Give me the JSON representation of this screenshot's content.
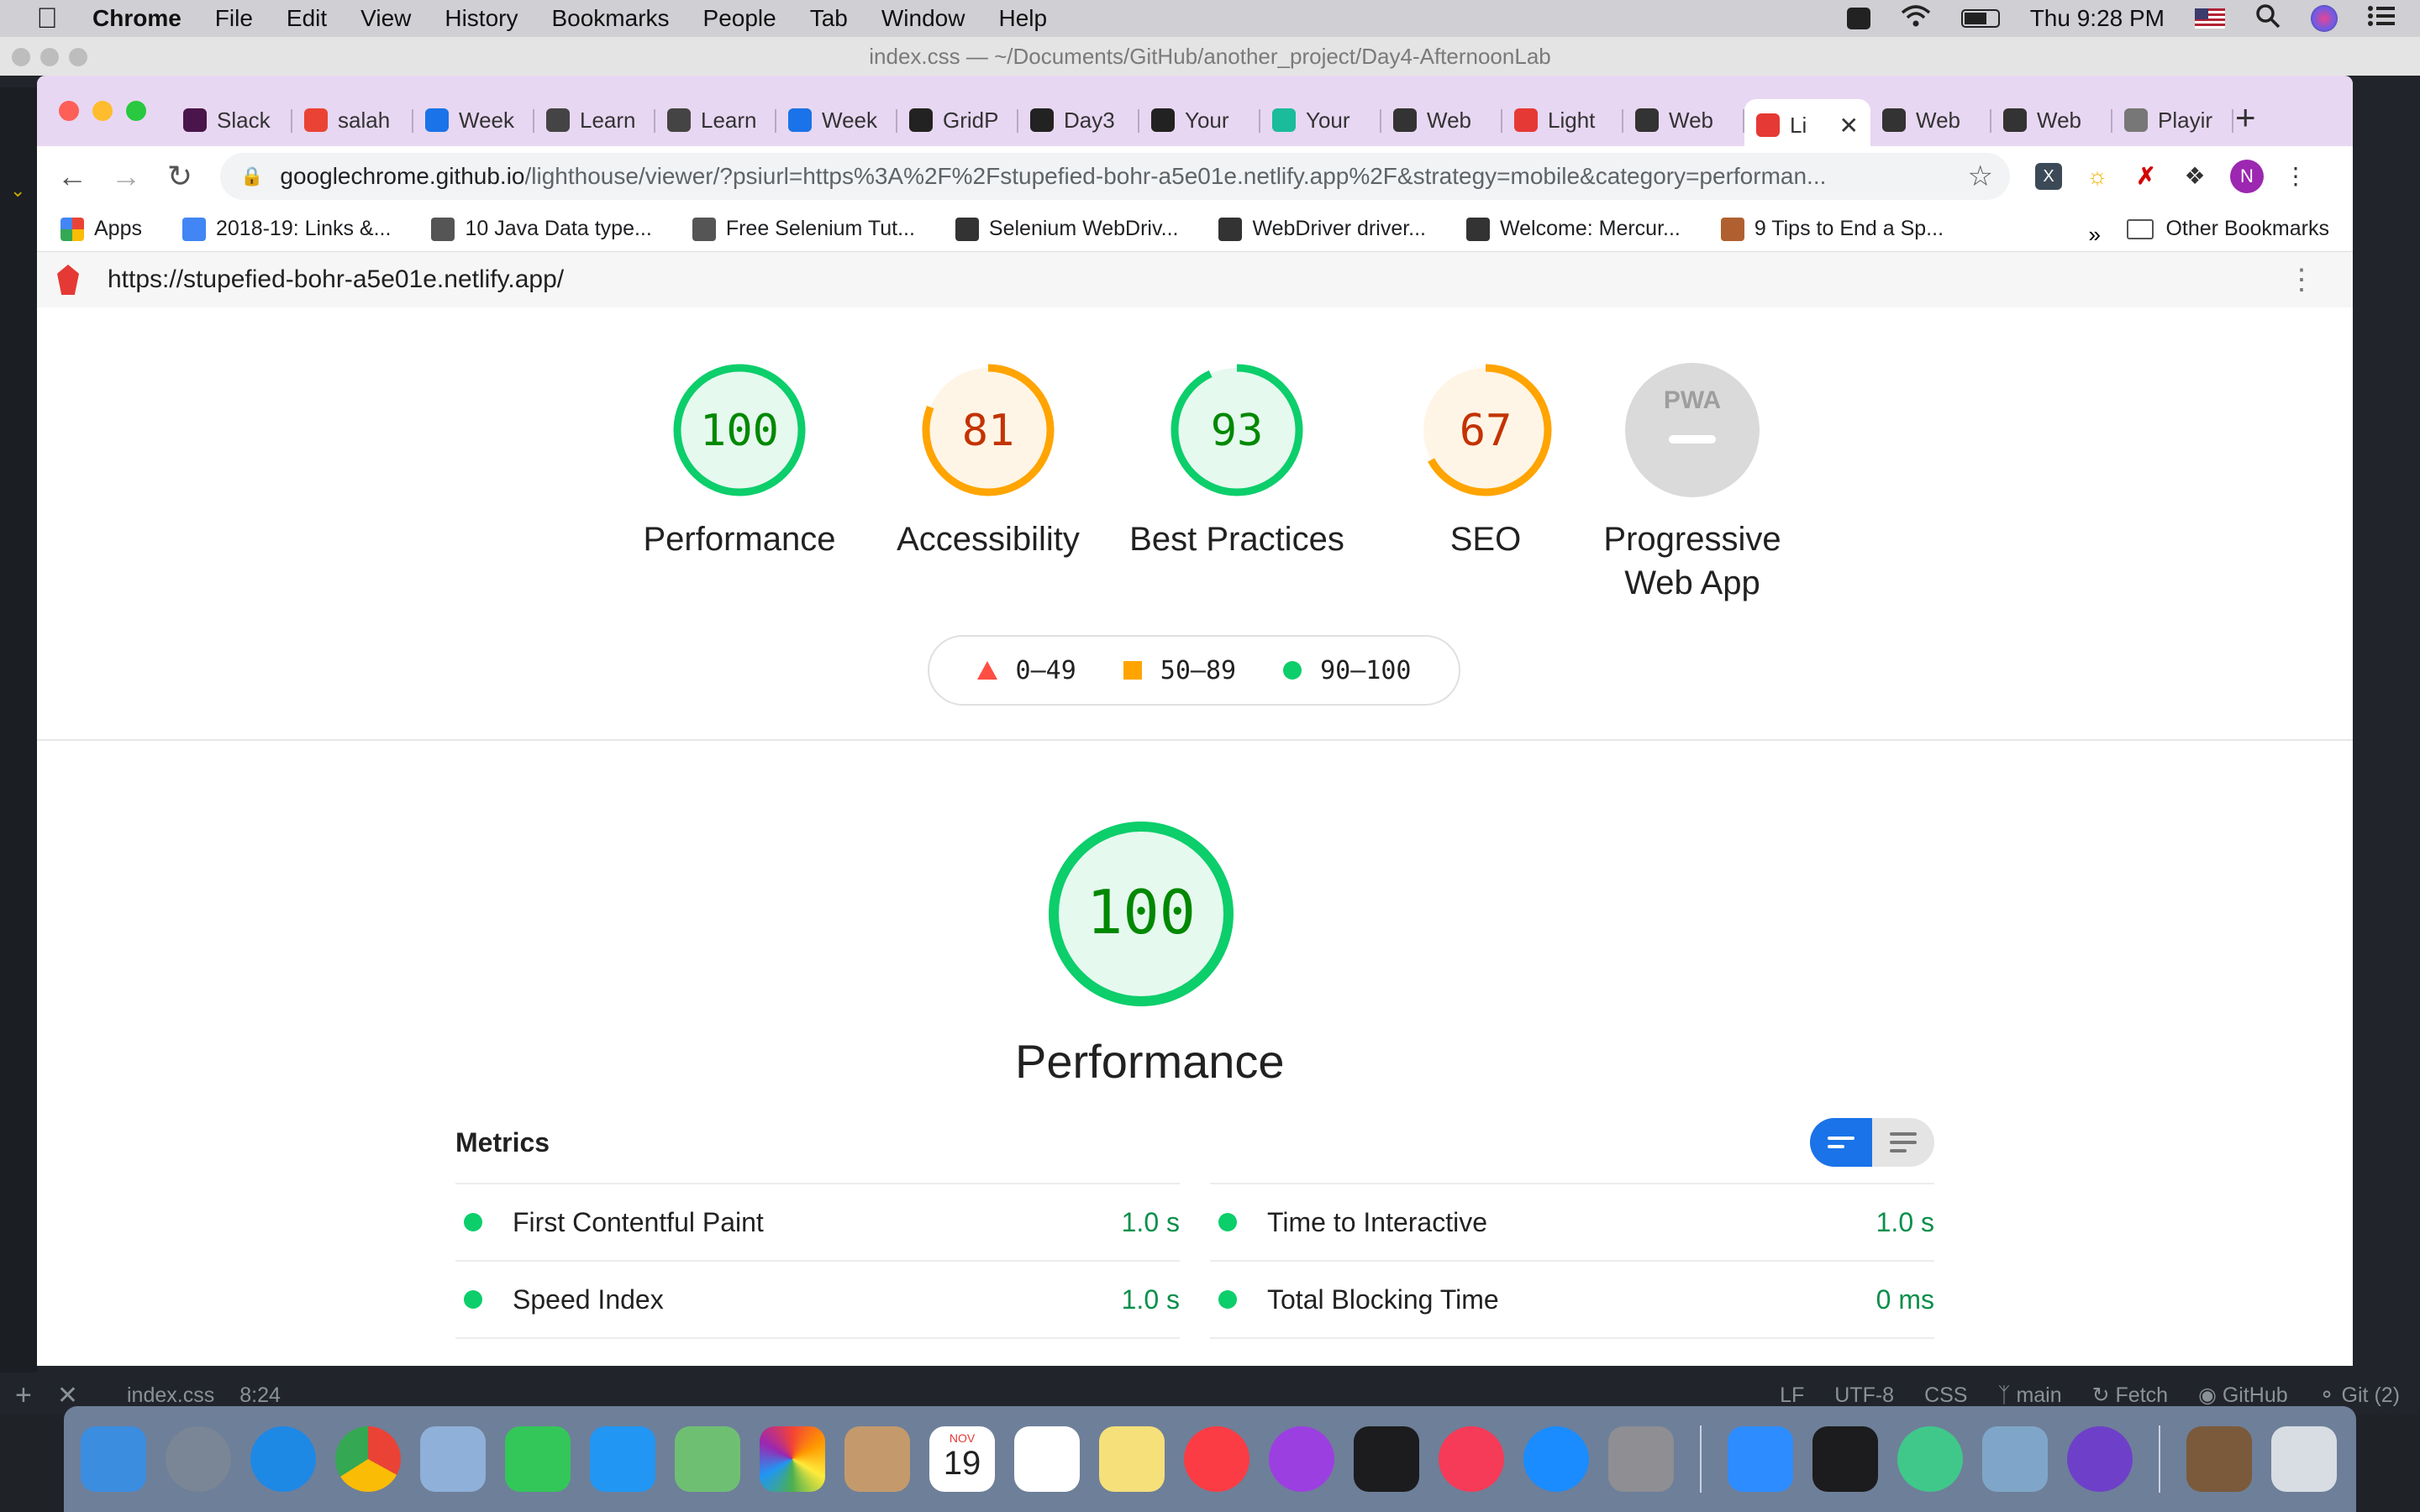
{
  "menubar": {
    "app_name": "Chrome",
    "items": [
      "File",
      "Edit",
      "View",
      "History",
      "Bookmarks",
      "People",
      "Tab",
      "Window",
      "Help"
    ],
    "clock": "Thu 9:28 PM"
  },
  "editor": {
    "title": "index.css — ~/Documents/GitHub/another_project/Day4-AfternoonLab",
    "status_left": {
      "file": "index.css",
      "cursor": "8:24"
    },
    "status_right": [
      "LF",
      "UTF-8",
      "CSS",
      "main",
      "Fetch",
      "GitHub",
      "Git (2)"
    ]
  },
  "tabs": [
    {
      "label": "Slack",
      "color": "#4a154b"
    },
    {
      "label": "salah",
      "color": "#ea4335"
    },
    {
      "label": "Week",
      "color": "#1a73e8"
    },
    {
      "label": "Learn",
      "color": "#444444"
    },
    {
      "label": "Learn",
      "color": "#444444"
    },
    {
      "label": "Week",
      "color": "#1a73e8"
    },
    {
      "label": "GridP",
      "color": "#222222"
    },
    {
      "label": "Day3",
      "color": "#222222"
    },
    {
      "label": "Your",
      "color": "#222222"
    },
    {
      "label": "Your",
      "color": "#1abc9c"
    },
    {
      "label": "Web",
      "color": "#333333"
    },
    {
      "label": "Light",
      "color": "#e53935"
    },
    {
      "label": "Web",
      "color": "#333333"
    },
    {
      "label": "Li",
      "color": "#e53935",
      "active": true
    },
    {
      "label": "Web",
      "color": "#333333"
    },
    {
      "label": "Web",
      "color": "#333333"
    },
    {
      "label": "Playir",
      "color": "#777777"
    }
  ],
  "omnibox": {
    "host": "googlechrome.github.io",
    "path": "/lighthouse/viewer/?psiurl=https%3A%2F%2Fstupefied-bohr-a5e01e.netlify.app%2F&strategy=mobile&category=performan..."
  },
  "profile_initial": "N",
  "bookmarks": [
    {
      "label": "Apps",
      "color": "#e8453c"
    },
    {
      "label": "2018-19: Links &...",
      "color": "#4285f4"
    },
    {
      "label": "10 Java Data type...",
      "color": "#555555"
    },
    {
      "label": "Free Selenium Tut...",
      "color": "#555555"
    },
    {
      "label": "Selenium WebDriv...",
      "color": "#333333"
    },
    {
      "label": "WebDriver driver...",
      "color": "#333333"
    },
    {
      "label": "Welcome: Mercur...",
      "color": "#333333"
    },
    {
      "label": "9 Tips to End a Sp...",
      "color": "#b06030"
    }
  ],
  "bookmarks_more": "»",
  "other_bookmarks": "Other Bookmarks",
  "lighthouse": {
    "url": "https://stupefied-bohr-a5e01e.netlify.app/",
    "categories": [
      {
        "label": "Performance",
        "score": 100,
        "color": "#0cce6b",
        "text_color": "#008800",
        "fill": "#e6f9ef"
      },
      {
        "label": "Accessibility",
        "score": 81,
        "color": "#ffa400",
        "text_color": "#c33300",
        "fill": "#fff5e6"
      },
      {
        "label": "Best Practices",
        "score": 93,
        "color": "#0cce6b",
        "text_color": "#008800",
        "fill": "#e6f9ef"
      },
      {
        "label": "SEO",
        "score": 67,
        "color": "#ffa400",
        "text_color": "#c33300",
        "fill": "#fff5e6"
      }
    ],
    "pwa": {
      "label_line1": "Progressive",
      "label_line2": "Web App",
      "badge": "PWA"
    },
    "legend": [
      {
        "range": "0–49",
        "shape": "triangle",
        "color": "#ff4e42"
      },
      {
        "range": "50–89",
        "shape": "square",
        "color": "#ffa400"
      },
      {
        "range": "90–100",
        "shape": "circle",
        "color": "#0cce6b"
      }
    ],
    "main": {
      "score": 100,
      "title": "Performance"
    },
    "metrics_title": "Metrics",
    "metrics_left": [
      {
        "name": "First Contentful Paint",
        "value": "1.0 s"
      },
      {
        "name": "Speed Index",
        "value": "1.0 s"
      }
    ],
    "metrics_right": [
      {
        "name": "Time to Interactive",
        "value": "1.0 s"
      },
      {
        "name": "Total Blocking Time",
        "value": "0 ms"
      }
    ]
  },
  "dock_calendar": {
    "month": "NOV",
    "day": "19"
  },
  "dock_icons": [
    "finder-icon",
    "launchpad-icon",
    "safari-icon",
    "chrome-icon",
    "preview-icon",
    "facetime-icon",
    "messages-icon",
    "maps-icon",
    "photos-icon",
    "contacts-icon",
    "calendar-icon",
    "reminders-icon",
    "notes-icon",
    "music-icon",
    "podcasts-icon",
    "tv-icon",
    "news-icon",
    "app-store-icon",
    "system-preferences-icon",
    "zoom-icon",
    "terminal-icon",
    "atom-icon",
    "image-viewer-icon",
    "github-desktop-icon",
    "photo-stack-icon",
    "trash-icon"
  ]
}
